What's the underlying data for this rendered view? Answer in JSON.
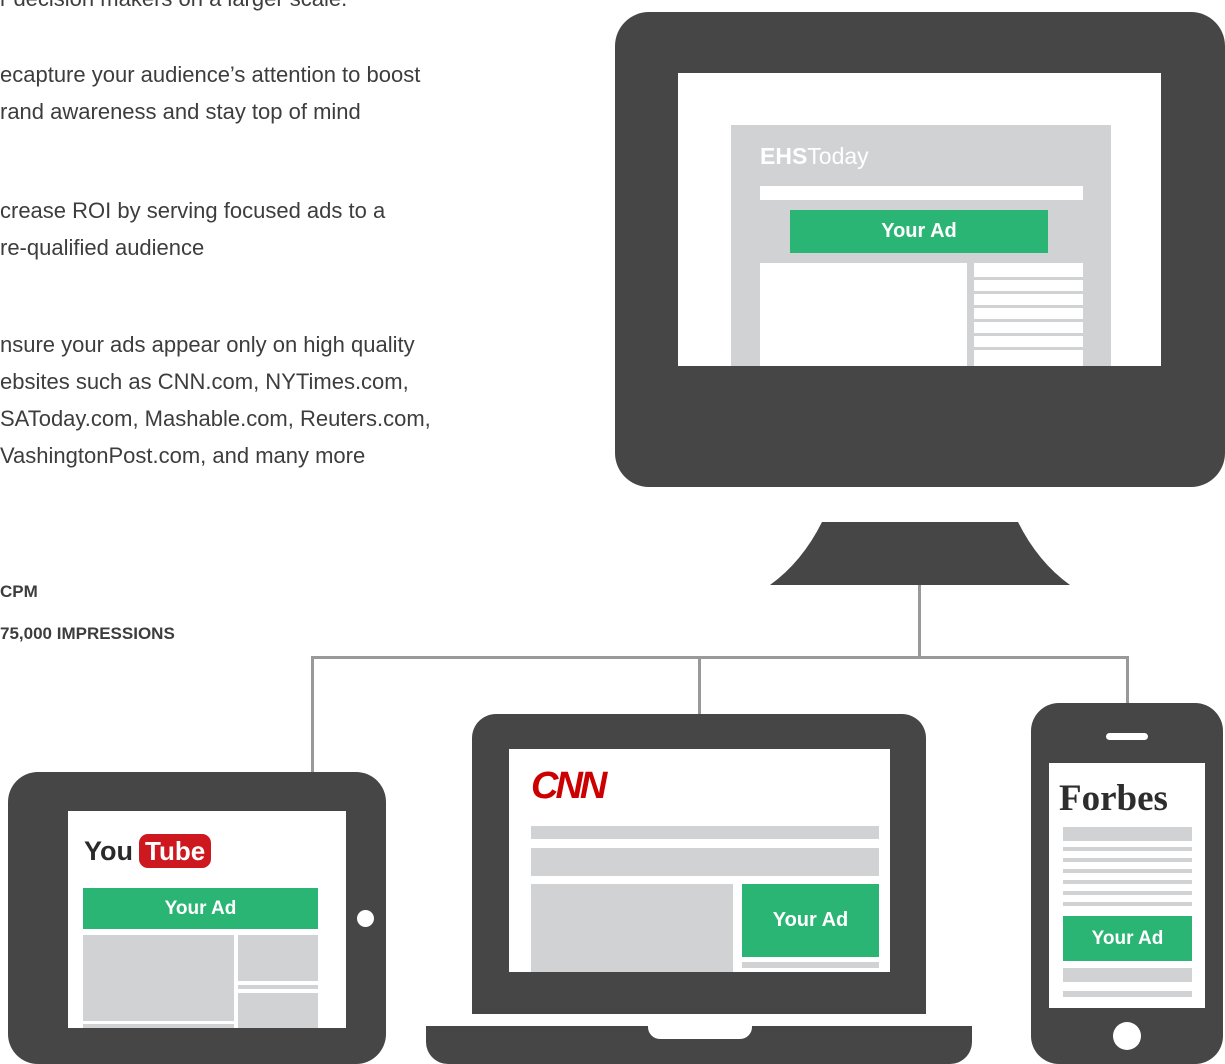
{
  "intro": {
    "partial_line": "r decision makers on a larger scale."
  },
  "benefits": [
    {
      "lines": [
        "ecapture your audience’s attention to boost",
        "rand awareness and stay top of mind"
      ]
    },
    {
      "lines": [
        "crease ROI by serving focused ads to a",
        "re-qualified audience"
      ]
    },
    {
      "lines": [
        "nsure your ads appear only on high quality",
        "ebsites such as CNN.com, NYTimes.com,",
        "SAToday.com, Mashable.com, Reuters.com,",
        "VashingtonPost.com, and many more"
      ]
    }
  ],
  "pricing": {
    "cpm_label": "CPM",
    "impressions_label": "75,000 IMPRESSIONS"
  },
  "devices": {
    "desktop": {
      "site_logo_bold": "EHS",
      "site_logo_light": "Today",
      "ad_label": "Your Ad"
    },
    "tablet": {
      "logo_you": "You",
      "logo_tube": "Tube",
      "ad_label": "Your Ad"
    },
    "laptop": {
      "logo": "CNN",
      "ad_label": "Your Ad"
    },
    "phone": {
      "logo": "Forbes",
      "ad_label": "Your Ad"
    }
  },
  "colors": {
    "device_dark": "#464646",
    "ad_green": "#2ab574",
    "placeholder_gray": "#d1d2d4",
    "youtube_red": "#cc181e",
    "cnn_red": "#cc0000",
    "forbes_dark": "#2d2d2d"
  }
}
